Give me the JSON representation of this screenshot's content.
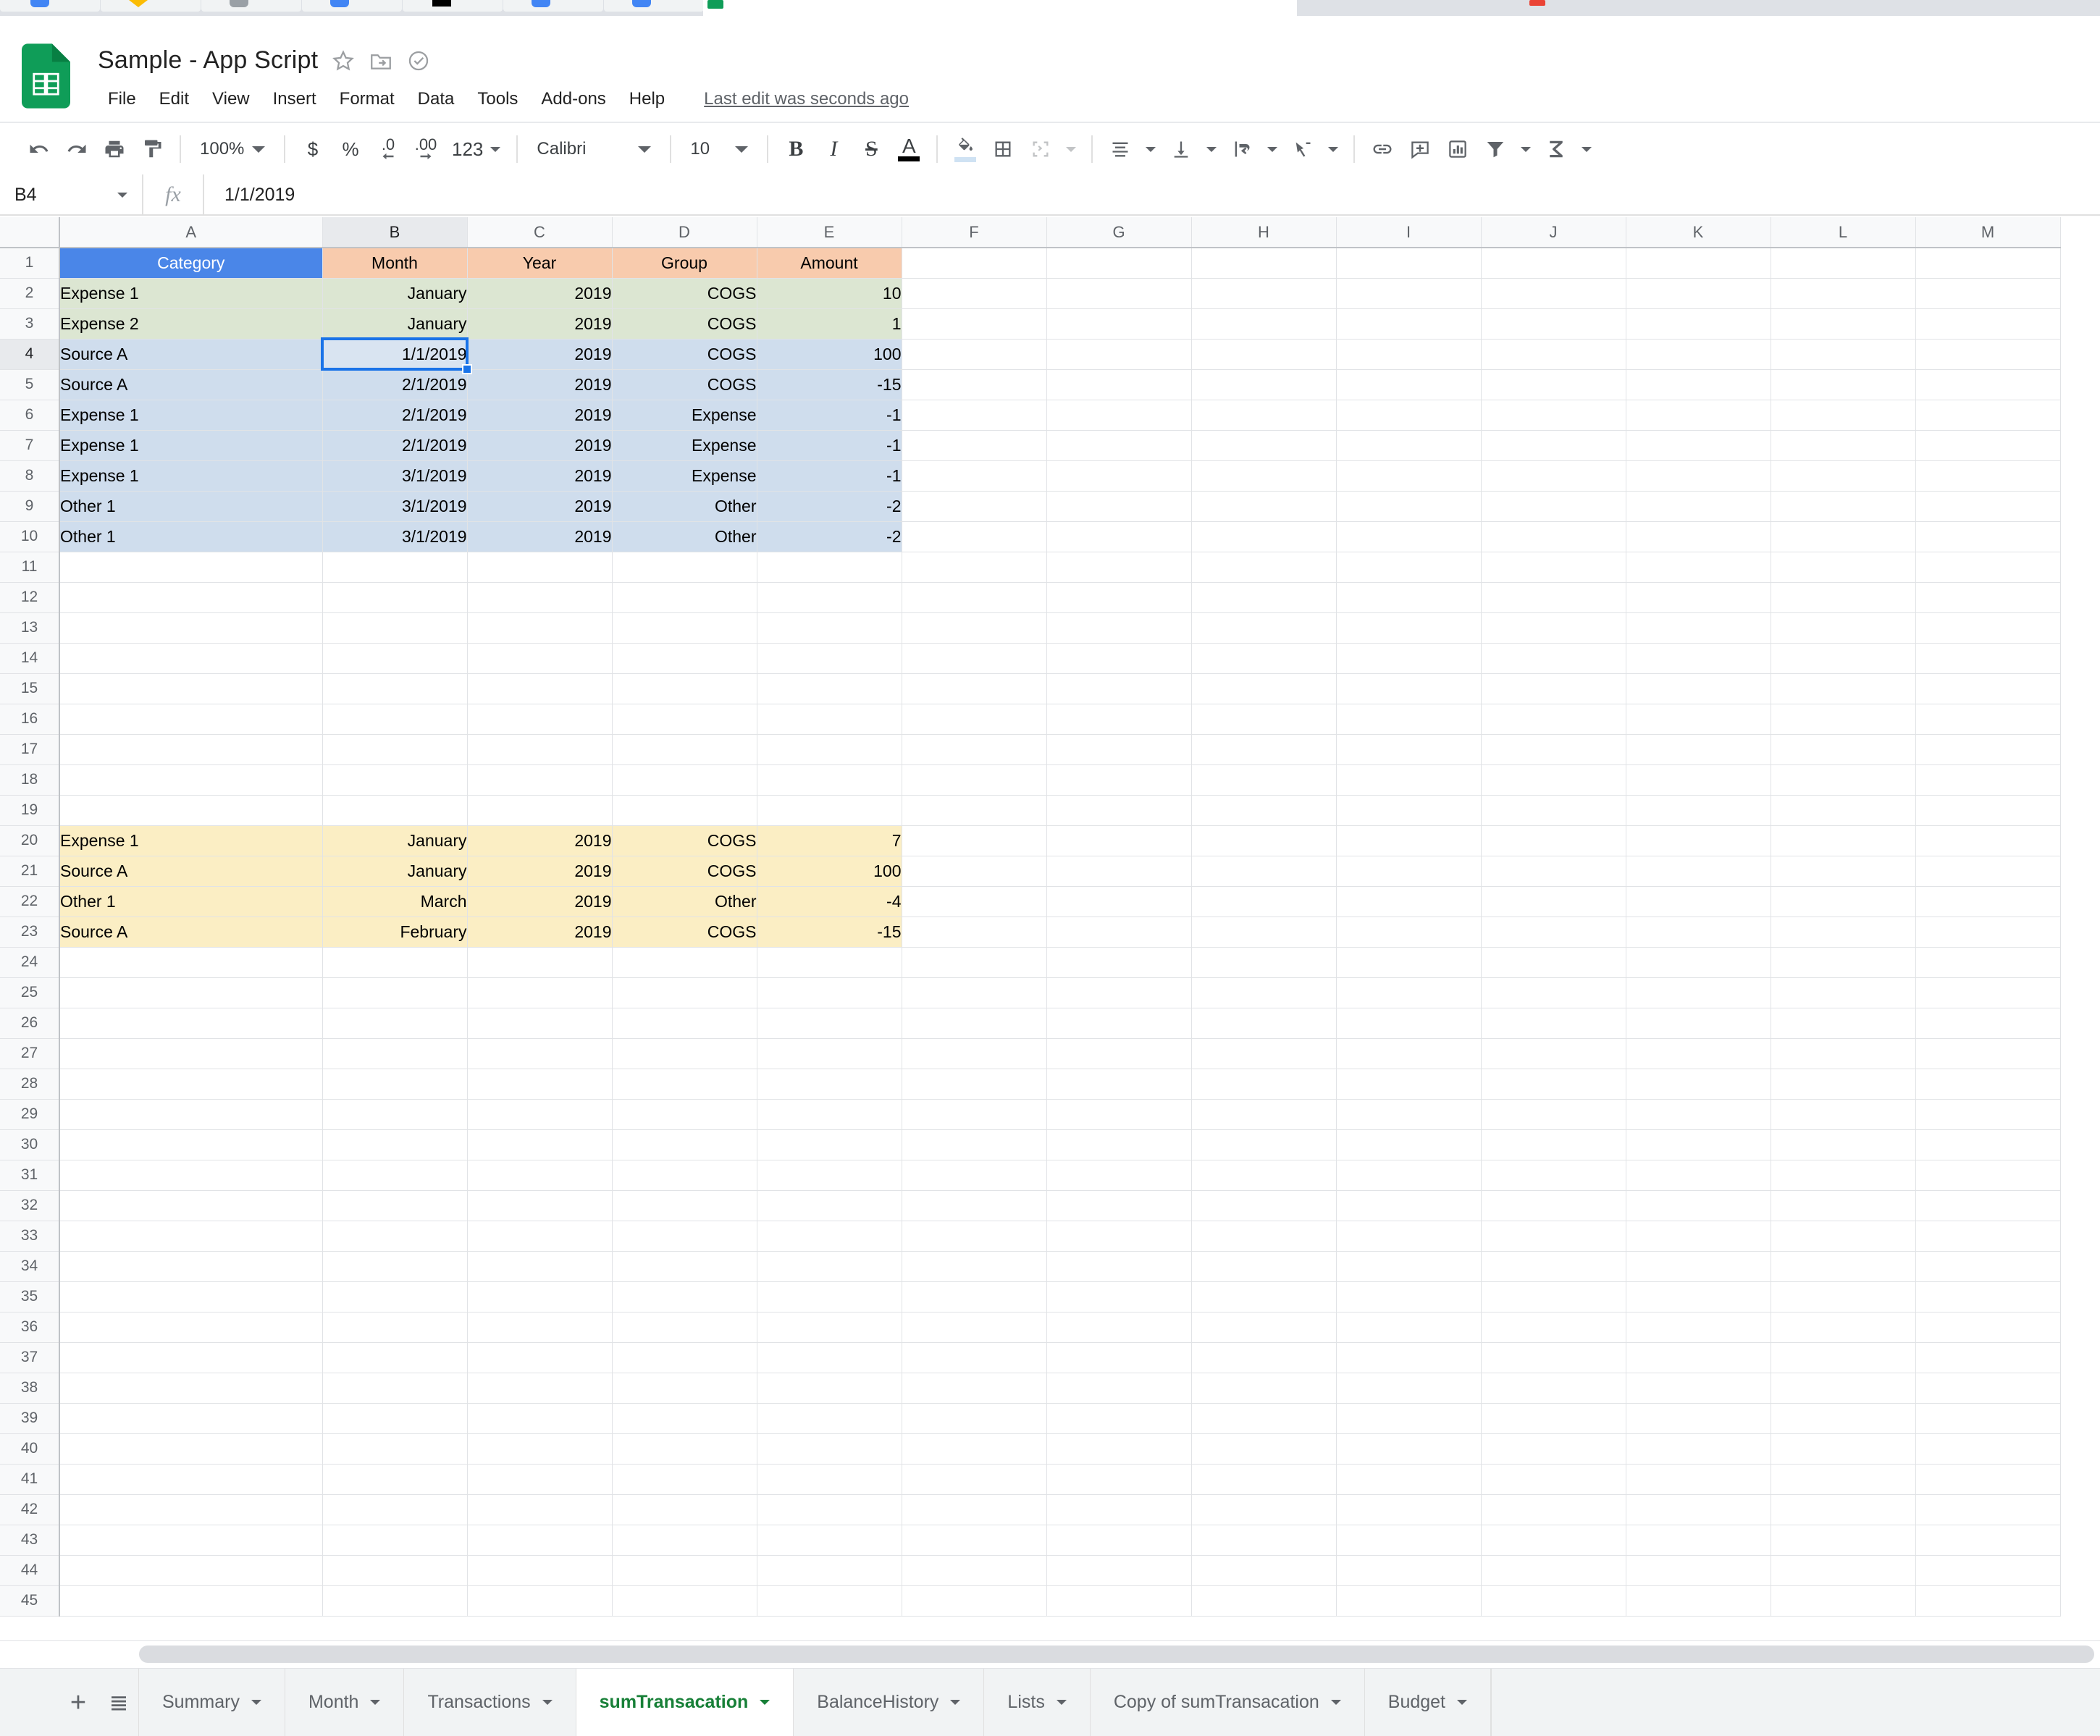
{
  "browser": {
    "favicon_colors": [
      "#4285f4",
      "#fbbc04",
      "#9aa0a6",
      "#4285f4",
      "#000000",
      "#4285f4",
      "#4285f4",
      "#ea4335"
    ],
    "active_tab_favicon": "#0f9d58",
    "second_window_favicon": "#ea4335"
  },
  "header": {
    "title": "Sample - App Script",
    "icons": [
      "star-icon",
      "move-to-folder-icon",
      "cloud-status-icon"
    ],
    "menu": [
      "File",
      "Edit",
      "View",
      "Insert",
      "Format",
      "Data",
      "Tools",
      "Add-ons",
      "Help"
    ],
    "last_edit": "Last edit was seconds ago"
  },
  "toolbar": {
    "zoom": "100%",
    "currency_label": "$",
    "percent_label": "%",
    "dec_decrease_label": ".0",
    "dec_increase_label": ".00",
    "formats_label": "123",
    "font_family": "Calibri",
    "font_size": "10",
    "bold_label": "B",
    "italic_label": "I",
    "strike_label": "S",
    "text_color_label": "A",
    "text_color_value": "#000000",
    "fill_color_value": "#cfe2f3"
  },
  "formula_bar": {
    "name_box": "B4",
    "fx_label": "fx",
    "value": "1/1/2019"
  },
  "grid": {
    "columns": [
      "A",
      "B",
      "C",
      "D",
      "E",
      "F",
      "G",
      "H",
      "I",
      "J",
      "K",
      "L",
      "M"
    ],
    "selected_column": "B",
    "selected_row": 4,
    "total_rows": 45,
    "colors": {
      "header_blue": "#4a86e8",
      "header_orange": "#f8cbad",
      "band_green": "#dce6d2",
      "band_blue": "#cfdded",
      "band_yellow": "#fbeec4",
      "selection_border": "#1a73e8"
    },
    "rows": [
      {
        "n": 1,
        "fill": "header",
        "cells": [
          {
            "v": "Category",
            "align": "c",
            "bg": "#4a86e8",
            "color": "#ffffff"
          },
          {
            "v": "Month",
            "align": "c",
            "bg": "#f8cbad"
          },
          {
            "v": "Year",
            "align": "c",
            "bg": "#f8cbad"
          },
          {
            "v": "Group",
            "align": "c",
            "bg": "#f8cbad"
          },
          {
            "v": "Amount",
            "align": "c",
            "bg": "#f8cbad"
          }
        ]
      },
      {
        "n": 2,
        "cells": [
          {
            "v": "Expense 1",
            "align": "l",
            "bg": "#dce6d2"
          },
          {
            "v": "January",
            "align": "r",
            "bg": "#dce6d2"
          },
          {
            "v": "2019",
            "align": "r",
            "bg": "#dce6d2"
          },
          {
            "v": "COGS",
            "align": "r",
            "bg": "#dce6d2"
          },
          {
            "v": "10",
            "align": "r",
            "bg": "#dce6d2"
          }
        ]
      },
      {
        "n": 3,
        "cells": [
          {
            "v": "Expense 2",
            "align": "l",
            "bg": "#dce6d2"
          },
          {
            "v": "January",
            "align": "r",
            "bg": "#dce6d2"
          },
          {
            "v": "2019",
            "align": "r",
            "bg": "#dce6d2"
          },
          {
            "v": "COGS",
            "align": "r",
            "bg": "#dce6d2"
          },
          {
            "v": "1",
            "align": "r",
            "bg": "#dce6d2"
          }
        ]
      },
      {
        "n": 4,
        "cells": [
          {
            "v": "Source A",
            "align": "l",
            "bg": "#cfdded"
          },
          {
            "v": "1/1/2019",
            "align": "r",
            "bg": "#d9e4f1"
          },
          {
            "v": "2019",
            "align": "r",
            "bg": "#cfdded"
          },
          {
            "v": "COGS",
            "align": "r",
            "bg": "#cfdded"
          },
          {
            "v": "100",
            "align": "r",
            "bg": "#cfdded"
          }
        ]
      },
      {
        "n": 5,
        "cells": [
          {
            "v": "Source A",
            "align": "l",
            "bg": "#cfdded"
          },
          {
            "v": "2/1/2019",
            "align": "r",
            "bg": "#cfdded"
          },
          {
            "v": "2019",
            "align": "r",
            "bg": "#cfdded"
          },
          {
            "v": "COGS",
            "align": "r",
            "bg": "#cfdded"
          },
          {
            "v": "-15",
            "align": "r",
            "bg": "#cfdded"
          }
        ]
      },
      {
        "n": 6,
        "cells": [
          {
            "v": "Expense 1",
            "align": "l",
            "bg": "#cfdded"
          },
          {
            "v": "2/1/2019",
            "align": "r",
            "bg": "#cfdded"
          },
          {
            "v": "2019",
            "align": "r",
            "bg": "#cfdded"
          },
          {
            "v": "Expense",
            "align": "r",
            "bg": "#cfdded"
          },
          {
            "v": "-1",
            "align": "r",
            "bg": "#cfdded"
          }
        ]
      },
      {
        "n": 7,
        "cells": [
          {
            "v": "Expense 1",
            "align": "l",
            "bg": "#cfdded"
          },
          {
            "v": "2/1/2019",
            "align": "r",
            "bg": "#cfdded"
          },
          {
            "v": "2019",
            "align": "r",
            "bg": "#cfdded"
          },
          {
            "v": "Expense",
            "align": "r",
            "bg": "#cfdded"
          },
          {
            "v": "-1",
            "align": "r",
            "bg": "#cfdded"
          }
        ]
      },
      {
        "n": 8,
        "cells": [
          {
            "v": "Expense 1",
            "align": "l",
            "bg": "#cfdded"
          },
          {
            "v": "3/1/2019",
            "align": "r",
            "bg": "#cfdded"
          },
          {
            "v": "2019",
            "align": "r",
            "bg": "#cfdded"
          },
          {
            "v": "Expense",
            "align": "r",
            "bg": "#cfdded"
          },
          {
            "v": "-1",
            "align": "r",
            "bg": "#cfdded"
          }
        ]
      },
      {
        "n": 9,
        "cells": [
          {
            "v": "Other 1",
            "align": "l",
            "bg": "#cfdded"
          },
          {
            "v": "3/1/2019",
            "align": "r",
            "bg": "#cfdded"
          },
          {
            "v": "2019",
            "align": "r",
            "bg": "#cfdded"
          },
          {
            "v": "Other",
            "align": "r",
            "bg": "#cfdded"
          },
          {
            "v": "-2",
            "align": "r",
            "bg": "#cfdded"
          }
        ]
      },
      {
        "n": 10,
        "cells": [
          {
            "v": "Other 1",
            "align": "l",
            "bg": "#cfdded"
          },
          {
            "v": "3/1/2019",
            "align": "r",
            "bg": "#cfdded"
          },
          {
            "v": "2019",
            "align": "r",
            "bg": "#cfdded"
          },
          {
            "v": "Other",
            "align": "r",
            "bg": "#cfdded"
          },
          {
            "v": "-2",
            "align": "r",
            "bg": "#cfdded"
          }
        ]
      },
      {
        "n": 11,
        "cells": []
      },
      {
        "n": 12,
        "cells": []
      },
      {
        "n": 13,
        "cells": []
      },
      {
        "n": 14,
        "cells": []
      },
      {
        "n": 15,
        "cells": []
      },
      {
        "n": 16,
        "cells": []
      },
      {
        "n": 17,
        "cells": []
      },
      {
        "n": 18,
        "cells": []
      },
      {
        "n": 19,
        "cells": []
      },
      {
        "n": 20,
        "cells": [
          {
            "v": "Expense 1",
            "align": "l",
            "bg": "#fbeec4"
          },
          {
            "v": "January",
            "align": "r",
            "bg": "#fbeec4"
          },
          {
            "v": "2019",
            "align": "r",
            "bg": "#fbeec4"
          },
          {
            "v": "COGS",
            "align": "r",
            "bg": "#fbeec4"
          },
          {
            "v": "7",
            "align": "r",
            "bg": "#fbeec4"
          }
        ]
      },
      {
        "n": 21,
        "cells": [
          {
            "v": "Source A",
            "align": "l",
            "bg": "#fbeec4"
          },
          {
            "v": "January",
            "align": "r",
            "bg": "#fbeec4"
          },
          {
            "v": "2019",
            "align": "r",
            "bg": "#fbeec4"
          },
          {
            "v": "COGS",
            "align": "r",
            "bg": "#fbeec4"
          },
          {
            "v": "100",
            "align": "r",
            "bg": "#fbeec4"
          }
        ]
      },
      {
        "n": 22,
        "cells": [
          {
            "v": "Other 1",
            "align": "l",
            "bg": "#fbeec4"
          },
          {
            "v": "March",
            "align": "r",
            "bg": "#fbeec4"
          },
          {
            "v": "2019",
            "align": "r",
            "bg": "#fbeec4"
          },
          {
            "v": "Other",
            "align": "r",
            "bg": "#fbeec4"
          },
          {
            "v": "-4",
            "align": "r",
            "bg": "#fbeec4"
          }
        ]
      },
      {
        "n": 23,
        "cells": [
          {
            "v": "Source A",
            "align": "l",
            "bg": "#fbeec4"
          },
          {
            "v": "February",
            "align": "r",
            "bg": "#fbeec4"
          },
          {
            "v": "2019",
            "align": "r",
            "bg": "#fbeec4"
          },
          {
            "v": "COGS",
            "align": "r",
            "bg": "#fbeec4"
          },
          {
            "v": "-15",
            "align": "r",
            "bg": "#fbeec4"
          }
        ]
      },
      {
        "n": 24,
        "cells": []
      },
      {
        "n": 25,
        "cells": []
      },
      {
        "n": 26,
        "cells": []
      },
      {
        "n": 27,
        "cells": []
      },
      {
        "n": 28,
        "cells": []
      },
      {
        "n": 29,
        "cells": []
      },
      {
        "n": 30,
        "cells": []
      },
      {
        "n": 31,
        "cells": []
      },
      {
        "n": 32,
        "cells": []
      },
      {
        "n": 33,
        "cells": []
      },
      {
        "n": 34,
        "cells": []
      },
      {
        "n": 35,
        "cells": []
      },
      {
        "n": 36,
        "cells": []
      },
      {
        "n": 37,
        "cells": []
      },
      {
        "n": 38,
        "cells": []
      },
      {
        "n": 39,
        "cells": []
      },
      {
        "n": 40,
        "cells": []
      },
      {
        "n": 41,
        "cells": []
      },
      {
        "n": 42,
        "cells": []
      },
      {
        "n": 43,
        "cells": []
      },
      {
        "n": 44,
        "cells": []
      },
      {
        "n": 45,
        "cells": []
      }
    ]
  },
  "sheet_tabs": {
    "add_label": "+",
    "all_sheets_label": "all-sheets-icon",
    "tabs": [
      {
        "label": "Summary",
        "active": false
      },
      {
        "label": "Month",
        "active": false
      },
      {
        "label": "Transactions",
        "active": false
      },
      {
        "label": "sumTransacation",
        "active": true
      },
      {
        "label": "BalanceHistory",
        "active": false
      },
      {
        "label": "Lists",
        "active": false
      },
      {
        "label": "Copy of sumTransacation",
        "active": false
      },
      {
        "label": "Budget",
        "active": false
      }
    ]
  }
}
